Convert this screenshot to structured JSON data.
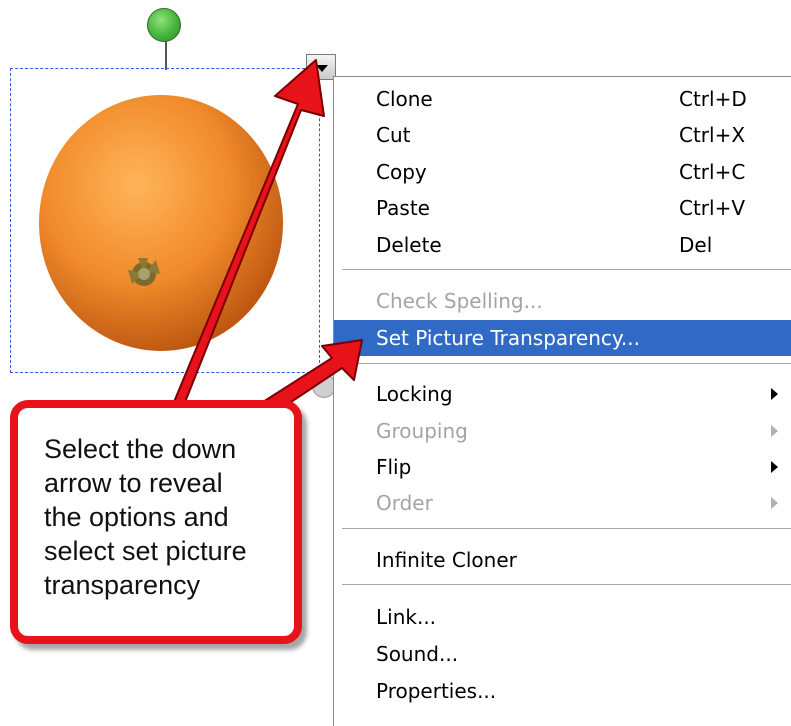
{
  "menu": {
    "items": [
      {
        "label": "Clone",
        "shortcut": "Ctrl+D"
      },
      {
        "label": "Cut",
        "shortcut": "Ctrl+X"
      },
      {
        "label": "Copy",
        "shortcut": "Ctrl+C"
      },
      {
        "label": "Paste",
        "shortcut": "Ctrl+V"
      },
      {
        "label": "Delete",
        "shortcut": "Del"
      },
      {
        "label": "Check Spelling...",
        "disabled": true
      },
      {
        "label": "Set Picture Transparency...",
        "highlighted": true
      },
      {
        "label": "Locking",
        "submenu": true
      },
      {
        "label": "Grouping",
        "submenu": true,
        "disabled": true
      },
      {
        "label": "Flip",
        "submenu": true
      },
      {
        "label": "Order",
        "submenu": true,
        "disabled": true
      },
      {
        "label": "Infinite Cloner"
      },
      {
        "label": "Link..."
      },
      {
        "label": "Sound..."
      },
      {
        "label": "Properties..."
      }
    ]
  },
  "callout": {
    "lines": [
      "Select the down",
      "arrow to reveal",
      "the options and",
      "select set picture",
      "transparency"
    ]
  },
  "colors": {
    "highlight": "#316ac5",
    "callout_border": "#e8121b",
    "arrow": "#e8121b",
    "selection_border": "#3b55e6",
    "rotation_handle": "#45b33b"
  },
  "icons": {
    "dropdown": "down-triangle-icon",
    "rotation": "rotation-handle-icon",
    "submenu": "right-triangle-icon"
  }
}
